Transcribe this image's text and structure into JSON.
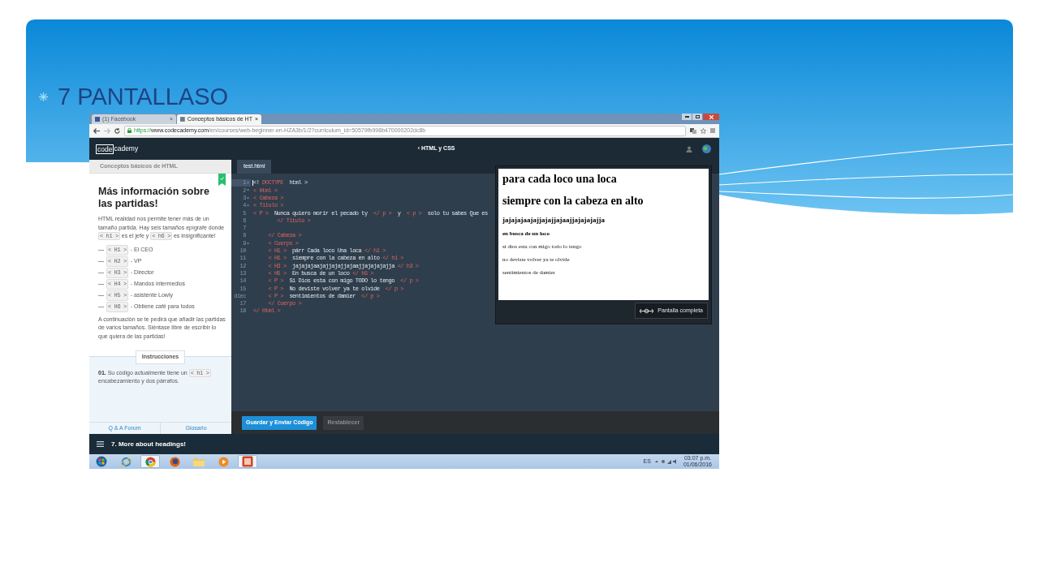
{
  "slide": {
    "title": "7 PANTALLASO"
  },
  "browser": {
    "tabs": [
      {
        "label": "(1) Facebook",
        "close": "×",
        "selected": false
      },
      {
        "label": "Conceptos básicos de HT",
        "close": "×",
        "selected": true
      }
    ],
    "url": {
      "scheme": "https://",
      "host": "www.codecademy.com",
      "path": "/en/courses/web-beginner-en-HZA3b/1/2?curriculum_id=50579fb998b470000202dc8b"
    }
  },
  "app": {
    "logo": {
      "boxed": "code",
      "rest": "cademy"
    },
    "course_link": "‹ HTML y CSS"
  },
  "lesson": {
    "header": "Conceptos básicos de HTML",
    "completed": true,
    "title": "Más información sobre las partidas!",
    "intro": [
      {
        "kind": "text",
        "text": "HTML realidad nos permite tener más de un tamaño partida. Hay seis tamaños epígrafe donde "
      },
      {
        "kind": "code",
        "text": "< h1 >"
      },
      {
        "kind": "text",
        "text": " es el jefe y "
      },
      {
        "kind": "code",
        "text": "< h6 >"
      },
      {
        "kind": "text",
        "text": " es insignificante!"
      }
    ],
    "levels": [
      {
        "dash": "—",
        "code": "< H1 >",
        "text": "- El CEO"
      },
      {
        "dash": "—",
        "code": "< H2 >",
        "text": "- VP"
      },
      {
        "dash": "—",
        "code": "< H3 >",
        "text": "- Director"
      },
      {
        "dash": "—",
        "code": "< H4 >",
        "text": "- Mandos intermedios"
      },
      {
        "dash": "—",
        "code": "< H5 >",
        "text": "- asistente Lowly"
      },
      {
        "dash": "—",
        "code": "< H6 >",
        "text": "- Obtiene café para todos"
      }
    ],
    "outro": "A continuación se te pedirá que añadir las partidas de varios tamaños. Siéntase libre de escribir lo que quiera de las partidas!",
    "instructions_label": "Instrucciones",
    "step": [
      {
        "kind": "number",
        "text": "01."
      },
      {
        "kind": "text",
        "text": " Su código actualmente tiene un "
      },
      {
        "kind": "code",
        "text": "< h1 >"
      },
      {
        "kind": "text",
        "text": " encabezamiento y dos párrafos."
      }
    ],
    "links": [
      "Q & A Forum",
      "Glosario"
    ]
  },
  "editor": {
    "tab": "test.html",
    "lines": [
      {
        "number": "1",
        "fold": true,
        "current": true,
        "tokens": [
          {
            "kind": "text",
            "text": "<! "
          },
          {
            "kind": "tag",
            "text": "DOCTYPE"
          },
          {
            "kind": "text",
            "text": "  html >"
          }
        ]
      },
      {
        "number": "2",
        "fold": true,
        "current": false,
        "tokens": [
          {
            "kind": "tag",
            "text": "< Html >"
          }
        ]
      },
      {
        "number": "3",
        "fold": true,
        "current": false,
        "tokens": [
          {
            "kind": "tag",
            "text": "< Cabeza >"
          }
        ]
      },
      {
        "number": "4",
        "fold": true,
        "current": false,
        "tokens": [
          {
            "kind": "tag",
            "text": "< Titulo >"
          }
        ]
      },
      {
        "number": "5",
        "fold": false,
        "current": false,
        "tokens": [
          {
            "kind": "tag",
            "text": "< P >"
          },
          {
            "kind": "text",
            "text": "  Nunca quiero morir el pecado ty  "
          },
          {
            "kind": "tag",
            "text": "</ p >"
          },
          {
            "kind": "text",
            "text": "  y  "
          },
          {
            "kind": "tag",
            "text": "< p >"
          },
          {
            "kind": "text",
            "text": "  solo tu sabes Que es"
          }
        ]
      },
      {
        "number": "6",
        "fold": false,
        "current": false,
        "tokens": [
          {
            "kind": "tag",
            "text": "        </ Titulo >"
          }
        ]
      },
      {
        "number": "7",
        "fold": false,
        "current": false
      },
      {
        "number": "8",
        "fold": false,
        "current": false,
        "tokens": [
          {
            "kind": "tag",
            "text": "     </ Cabeza >"
          }
        ]
      },
      {
        "number": "9",
        "fold": true,
        "current": false,
        "tokens": [
          {
            "kind": "tag",
            "text": "     < Cuerpo >"
          }
        ]
      },
      {
        "number": "10",
        "fold": false,
        "current": false,
        "tokens": [
          {
            "kind": "tag",
            "text": "     < H1 >"
          },
          {
            "kind": "text",
            "text": "  párr Cada loco Una loca "
          },
          {
            "kind": "tag",
            "text": "</ h1 >"
          }
        ]
      },
      {
        "number": "11",
        "fold": false,
        "current": false,
        "tokens": [
          {
            "kind": "tag",
            "text": "     < H1 >"
          },
          {
            "kind": "text",
            "text": "  siempre con la cabeza en alto "
          },
          {
            "kind": "tag",
            "text": "</ h1 >"
          }
        ]
      },
      {
        "number": "12",
        "fold": false,
        "current": false,
        "tokens": [
          {
            "kind": "tag",
            "text": "     < H3 >"
          },
          {
            "kind": "text",
            "text": "  jajajajaajajjajajjajaajjajajajajja "
          },
          {
            "kind": "tag",
            "text": "</ h3 >"
          }
        ]
      },
      {
        "number": "13",
        "fold": false,
        "current": false,
        "tokens": [
          {
            "kind": "tag",
            "text": "     < H5 >"
          },
          {
            "kind": "text",
            "text": "  En busca de un loco "
          },
          {
            "kind": "tag",
            "text": "</ h5 >"
          }
        ]
      },
      {
        "number": "14",
        "fold": false,
        "current": false,
        "tokens": [
          {
            "kind": "tag",
            "text": "     < P >"
          },
          {
            "kind": "text",
            "text": "  Si Dios esta con migo TODO lo tengo  "
          },
          {
            "kind": "tag",
            "text": "</ p >"
          }
        ]
      },
      {
        "number": "15",
        "fold": false,
        "current": false,
        "tokens": [
          {
            "kind": "tag",
            "text": "     < P >"
          },
          {
            "kind": "text",
            "text": "  No deviste volver ya te olvide  "
          },
          {
            "kind": "tag",
            "text": "</ p >"
          }
        ]
      },
      {
        "number": "diec",
        "fold": false,
        "current": false,
        "tokens": [
          {
            "kind": "tag",
            "text": "     < P >"
          },
          {
            "kind": "text",
            "text": "  sentimientos de damier  "
          },
          {
            "kind": "tag",
            "text": "</ p >"
          }
        ]
      },
      {
        "number": "17",
        "fold": false,
        "current": false,
        "tokens": [
          {
            "kind": "tag",
            "text": "     </ Cuerpo >"
          }
        ]
      },
      {
        "number": "18",
        "fold": false,
        "current": false,
        "tokens": [
          {
            "kind": "tag",
            "text": "</ Html >"
          }
        ]
      }
    ],
    "buttons": [
      {
        "label": "Guardar y Enviar Código",
        "kind": "primary"
      },
      {
        "label": "Restablecer",
        "kind": "secondary"
      }
    ]
  },
  "preview": {
    "elements": [
      {
        "kind": "h1",
        "text": "para cada loco una loca"
      },
      {
        "kind": "h1",
        "text": "siempre con la cabeza en alto"
      },
      {
        "kind": "h3",
        "text": "jajajajaajajjajajjajaajjajajajajja"
      },
      {
        "kind": "h5",
        "text": "en busca de un loco"
      },
      {
        "kind": "p",
        "text": "si dios esta con migo todo lo tengo"
      },
      {
        "kind": "p",
        "text": "no deviste volver ya te olvide"
      },
      {
        "kind": "p",
        "text": "sentimientos de damier"
      }
    ],
    "fullscreen_button": "Pantalla completa"
  },
  "footer": {
    "lesson_title": "7. More about headings!"
  },
  "taskbar": {
    "apps": [
      {
        "kind": "start",
        "selected": false
      },
      {
        "kind": "ie",
        "selected": false
      },
      {
        "kind": "chrome",
        "selected": true
      },
      {
        "kind": "firefox",
        "selected": false
      },
      {
        "kind": "folder",
        "selected": false
      },
      {
        "kind": "media",
        "selected": false
      },
      {
        "kind": "powerpoint",
        "selected": true
      }
    ],
    "language": "ES",
    "time": "03:07 p.m.",
    "date": "01/06/2016"
  }
}
